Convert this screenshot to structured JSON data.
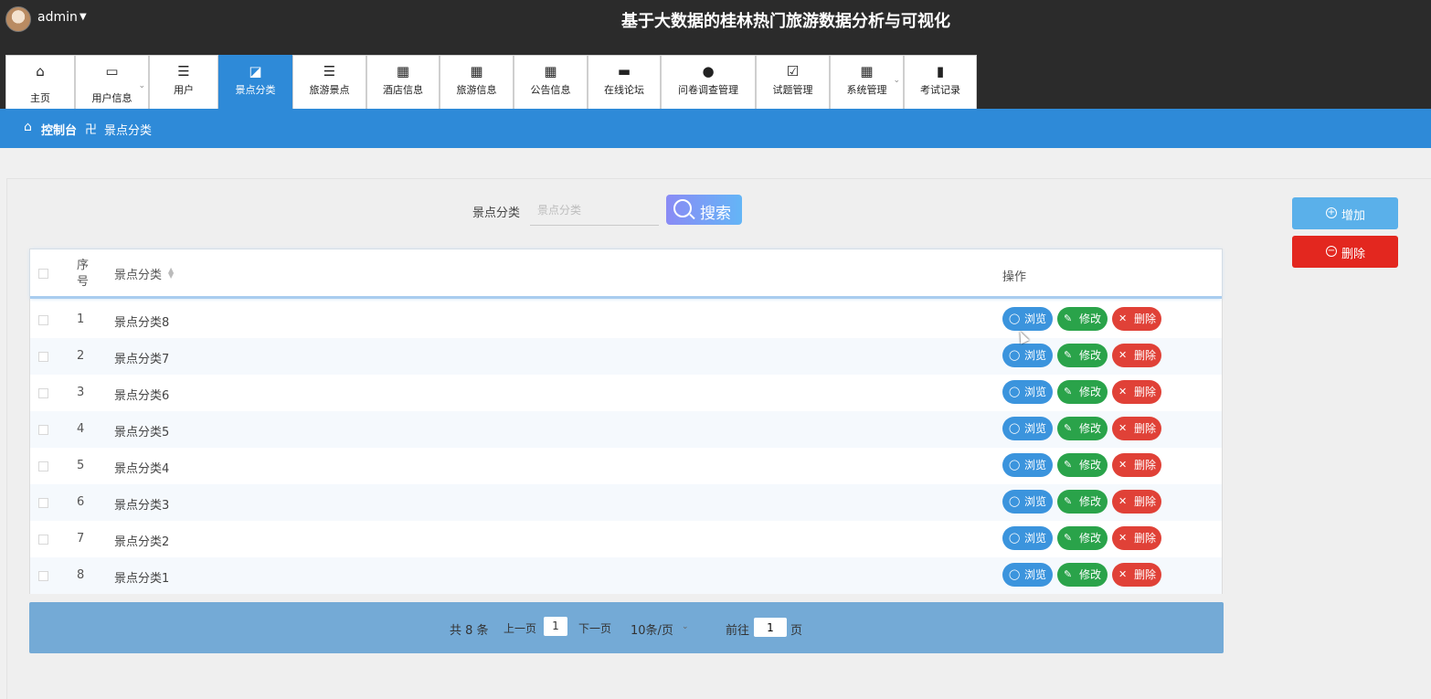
{
  "header": {
    "user": "admin",
    "title": "基于大数据的桂林热门旅游数据分析与可视化"
  },
  "nav": {
    "items": [
      {
        "label": "主页",
        "icon": "home-icon"
      },
      {
        "label": "用户信息",
        "icon": "wallet-icon"
      },
      {
        "label": "用户",
        "icon": "list-icon"
      },
      {
        "label": "景点分类",
        "icon": "chart-icon"
      },
      {
        "label": "旅游景点",
        "icon": "list-icon"
      },
      {
        "label": "酒店信息",
        "icon": "grid-icon"
      },
      {
        "label": "旅游信息",
        "icon": "grid-icon"
      },
      {
        "label": "公告信息",
        "icon": "grid-icon"
      },
      {
        "label": "在线论坛",
        "icon": "briefcase-icon"
      },
      {
        "label": "问卷调查管理",
        "icon": "bulb-icon"
      },
      {
        "label": "试题管理",
        "icon": "clipboard-check-icon"
      },
      {
        "label": "系统管理",
        "icon": "grid-icon"
      },
      {
        "label": "考试记录",
        "icon": "bar-chart-icon"
      }
    ],
    "active": "景点分类"
  },
  "breadcrumb": {
    "root": "控制台",
    "sep": "卍",
    "current": "景点分类"
  },
  "search": {
    "label": "景点分类",
    "placeholder": "景点分类",
    "button": "搜索"
  },
  "actions": {
    "add": "增加",
    "delete": "删除"
  },
  "table": {
    "headers": {
      "index": "序号",
      "category": "景点分类",
      "operations": "操作"
    },
    "rows": [
      {
        "index": "1",
        "category": "景点分类8"
      },
      {
        "index": "2",
        "category": "景点分类7"
      },
      {
        "index": "3",
        "category": "景点分类6"
      },
      {
        "index": "4",
        "category": "景点分类5"
      },
      {
        "index": "5",
        "category": "景点分类4"
      },
      {
        "index": "6",
        "category": "景点分类3"
      },
      {
        "index": "7",
        "category": "景点分类2"
      },
      {
        "index": "8",
        "category": "景点分类1"
      }
    ],
    "row_buttons": {
      "view": "浏览",
      "edit": "修改",
      "delete": "删除"
    }
  },
  "pagination": {
    "total": "共 8 条",
    "prev": "上一页",
    "page": "1",
    "next": "下一页",
    "page_size": "10条/页",
    "goto": "前往",
    "goto_value": "1",
    "unit": "页"
  }
}
